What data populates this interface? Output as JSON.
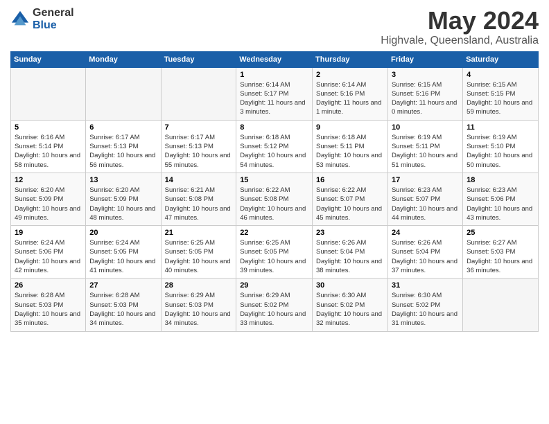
{
  "header": {
    "logo_general": "General",
    "logo_blue": "Blue",
    "month_title": "May 2024",
    "location": "Highvale, Queensland, Australia"
  },
  "calendar": {
    "days_of_week": [
      "Sunday",
      "Monday",
      "Tuesday",
      "Wednesday",
      "Thursday",
      "Friday",
      "Saturday"
    ],
    "weeks": [
      [
        {
          "day": "",
          "info": ""
        },
        {
          "day": "",
          "info": ""
        },
        {
          "day": "",
          "info": ""
        },
        {
          "day": "1",
          "info": "Sunrise: 6:14 AM\nSunset: 5:17 PM\nDaylight: 11 hours and 3 minutes."
        },
        {
          "day": "2",
          "info": "Sunrise: 6:14 AM\nSunset: 5:16 PM\nDaylight: 11 hours and 1 minute."
        },
        {
          "day": "3",
          "info": "Sunrise: 6:15 AM\nSunset: 5:16 PM\nDaylight: 11 hours and 0 minutes."
        },
        {
          "day": "4",
          "info": "Sunrise: 6:15 AM\nSunset: 5:15 PM\nDaylight: 10 hours and 59 minutes."
        }
      ],
      [
        {
          "day": "5",
          "info": "Sunrise: 6:16 AM\nSunset: 5:14 PM\nDaylight: 10 hours and 58 minutes."
        },
        {
          "day": "6",
          "info": "Sunrise: 6:17 AM\nSunset: 5:13 PM\nDaylight: 10 hours and 56 minutes."
        },
        {
          "day": "7",
          "info": "Sunrise: 6:17 AM\nSunset: 5:13 PM\nDaylight: 10 hours and 55 minutes."
        },
        {
          "day": "8",
          "info": "Sunrise: 6:18 AM\nSunset: 5:12 PM\nDaylight: 10 hours and 54 minutes."
        },
        {
          "day": "9",
          "info": "Sunrise: 6:18 AM\nSunset: 5:11 PM\nDaylight: 10 hours and 53 minutes."
        },
        {
          "day": "10",
          "info": "Sunrise: 6:19 AM\nSunset: 5:11 PM\nDaylight: 10 hours and 51 minutes."
        },
        {
          "day": "11",
          "info": "Sunrise: 6:19 AM\nSunset: 5:10 PM\nDaylight: 10 hours and 50 minutes."
        }
      ],
      [
        {
          "day": "12",
          "info": "Sunrise: 6:20 AM\nSunset: 5:09 PM\nDaylight: 10 hours and 49 minutes."
        },
        {
          "day": "13",
          "info": "Sunrise: 6:20 AM\nSunset: 5:09 PM\nDaylight: 10 hours and 48 minutes."
        },
        {
          "day": "14",
          "info": "Sunrise: 6:21 AM\nSunset: 5:08 PM\nDaylight: 10 hours and 47 minutes."
        },
        {
          "day": "15",
          "info": "Sunrise: 6:22 AM\nSunset: 5:08 PM\nDaylight: 10 hours and 46 minutes."
        },
        {
          "day": "16",
          "info": "Sunrise: 6:22 AM\nSunset: 5:07 PM\nDaylight: 10 hours and 45 minutes."
        },
        {
          "day": "17",
          "info": "Sunrise: 6:23 AM\nSunset: 5:07 PM\nDaylight: 10 hours and 44 minutes."
        },
        {
          "day": "18",
          "info": "Sunrise: 6:23 AM\nSunset: 5:06 PM\nDaylight: 10 hours and 43 minutes."
        }
      ],
      [
        {
          "day": "19",
          "info": "Sunrise: 6:24 AM\nSunset: 5:06 PM\nDaylight: 10 hours and 42 minutes."
        },
        {
          "day": "20",
          "info": "Sunrise: 6:24 AM\nSunset: 5:05 PM\nDaylight: 10 hours and 41 minutes."
        },
        {
          "day": "21",
          "info": "Sunrise: 6:25 AM\nSunset: 5:05 PM\nDaylight: 10 hours and 40 minutes."
        },
        {
          "day": "22",
          "info": "Sunrise: 6:25 AM\nSunset: 5:05 PM\nDaylight: 10 hours and 39 minutes."
        },
        {
          "day": "23",
          "info": "Sunrise: 6:26 AM\nSunset: 5:04 PM\nDaylight: 10 hours and 38 minutes."
        },
        {
          "day": "24",
          "info": "Sunrise: 6:26 AM\nSunset: 5:04 PM\nDaylight: 10 hours and 37 minutes."
        },
        {
          "day": "25",
          "info": "Sunrise: 6:27 AM\nSunset: 5:03 PM\nDaylight: 10 hours and 36 minutes."
        }
      ],
      [
        {
          "day": "26",
          "info": "Sunrise: 6:28 AM\nSunset: 5:03 PM\nDaylight: 10 hours and 35 minutes."
        },
        {
          "day": "27",
          "info": "Sunrise: 6:28 AM\nSunset: 5:03 PM\nDaylight: 10 hours and 34 minutes."
        },
        {
          "day": "28",
          "info": "Sunrise: 6:29 AM\nSunset: 5:03 PM\nDaylight: 10 hours and 34 minutes."
        },
        {
          "day": "29",
          "info": "Sunrise: 6:29 AM\nSunset: 5:02 PM\nDaylight: 10 hours and 33 minutes."
        },
        {
          "day": "30",
          "info": "Sunrise: 6:30 AM\nSunset: 5:02 PM\nDaylight: 10 hours and 32 minutes."
        },
        {
          "day": "31",
          "info": "Sunrise: 6:30 AM\nSunset: 5:02 PM\nDaylight: 10 hours and 31 minutes."
        },
        {
          "day": "",
          "info": ""
        }
      ]
    ]
  }
}
